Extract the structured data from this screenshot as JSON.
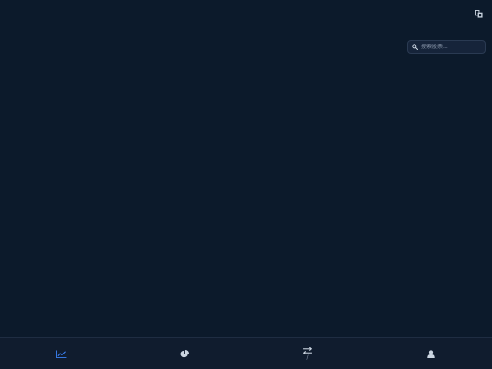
{
  "header": {
    "language_icon": "translate-icon"
  },
  "search": {
    "placeholder": "搜索股票...",
    "icon": "search-icon"
  },
  "bottom_nav": {
    "items": [
      {
        "icon": "line-chart-icon",
        "label": "",
        "active": true
      },
      {
        "icon": "pie-chart-icon",
        "label": "",
        "active": false
      },
      {
        "icon": "exchange-icon",
        "label": "/",
        "active": false
      },
      {
        "icon": "user-icon",
        "label": "",
        "active": false
      }
    ]
  },
  "colors": {
    "background": "#0c1a2b",
    "nav_background": "#101c2e",
    "accent": "#3b82f6",
    "icon": "#cbd5e1"
  }
}
